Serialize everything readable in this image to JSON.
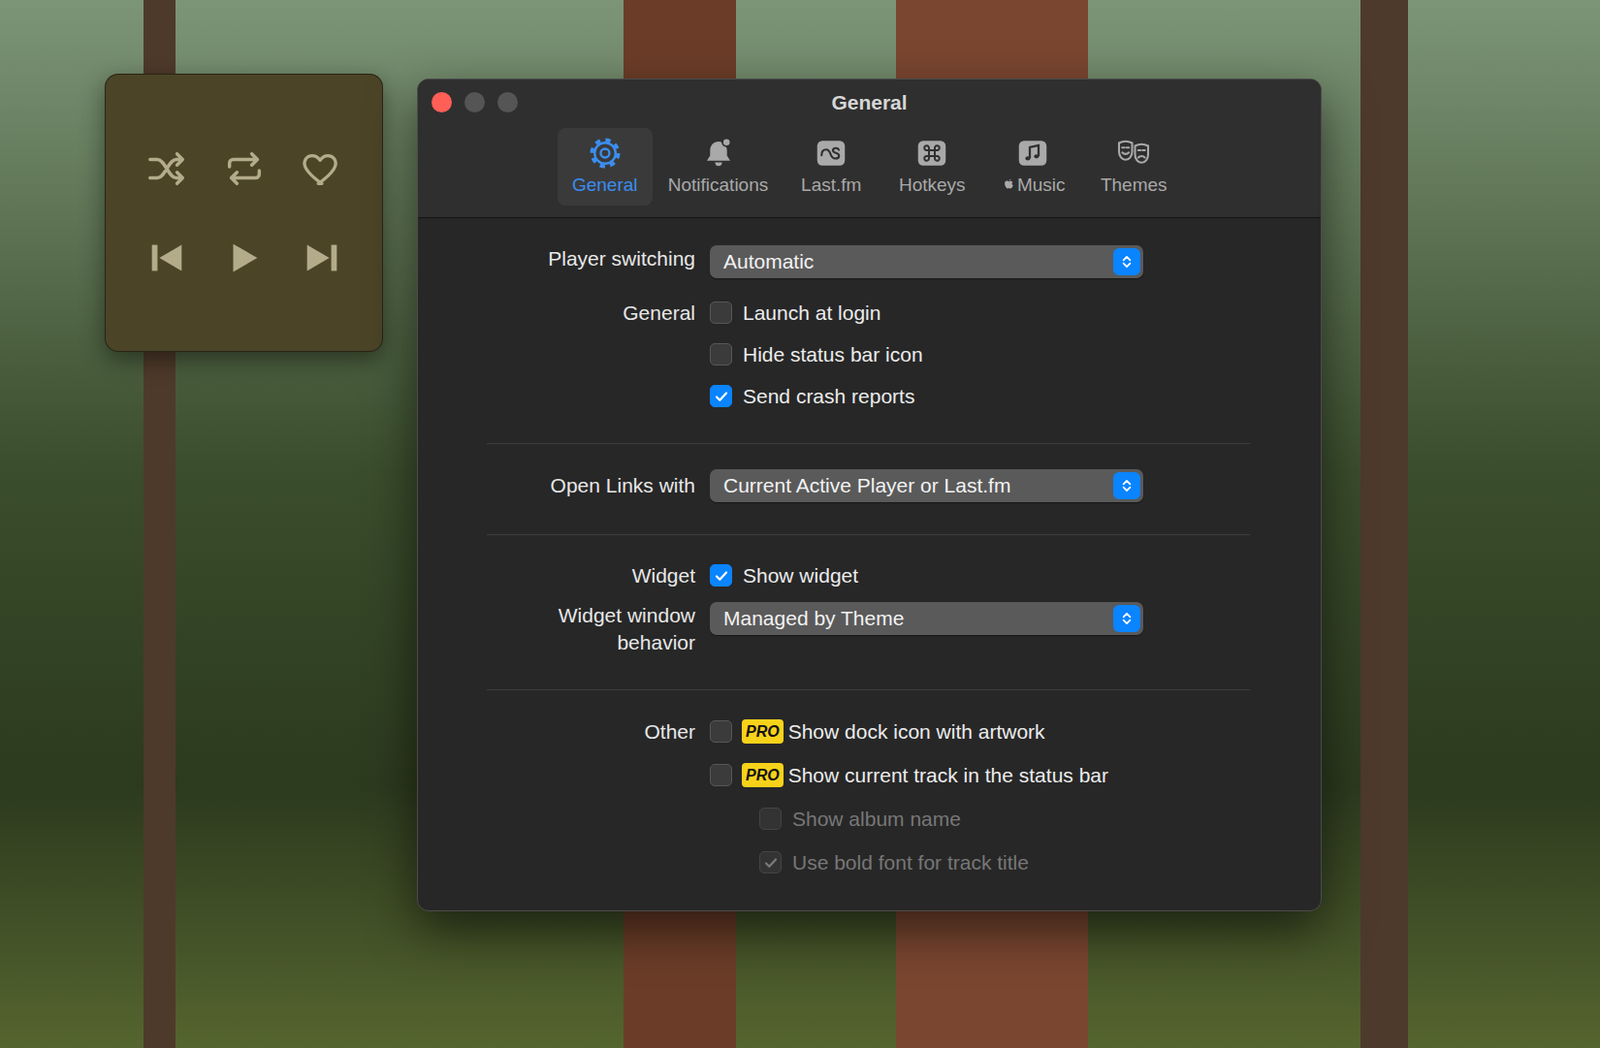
{
  "window": {
    "title": "General"
  },
  "tabs": [
    {
      "label": "General",
      "selected": true
    },
    {
      "label": "Notifications",
      "selected": false
    },
    {
      "label": "Last.fm",
      "selected": false
    },
    {
      "label": "Hotkeys",
      "selected": false
    },
    {
      "label": "Music",
      "selected": false
    },
    {
      "label": "Themes",
      "selected": false
    }
  ],
  "player_switching": {
    "label": "Player switching",
    "value": "Automatic"
  },
  "general": {
    "label": "General",
    "options": [
      {
        "label": "Launch at login",
        "checked": false
      },
      {
        "label": "Hide status bar icon",
        "checked": false
      },
      {
        "label": "Send crash reports",
        "checked": true
      }
    ]
  },
  "open_links": {
    "label": "Open Links with",
    "value": "Current Active Player or Last.fm"
  },
  "widget": {
    "label": "Widget",
    "option": {
      "label": "Show widget",
      "checked": true
    }
  },
  "widget_behavior": {
    "label": "Widget window behavior",
    "value": "Managed by Theme"
  },
  "other": {
    "label": "Other",
    "options": [
      {
        "label": "Show dock icon with artwork",
        "checked": false,
        "disabled": false,
        "badge": "PRO",
        "kind": "main"
      },
      {
        "label": "Show current track in the status bar",
        "checked": false,
        "disabled": false,
        "badge": "PRO",
        "kind": "main"
      },
      {
        "label": "Show album name",
        "checked": false,
        "disabled": true,
        "badge": "",
        "kind": "sub"
      },
      {
        "label": "Use bold font for track title",
        "checked": true,
        "disabled": true,
        "badge": "",
        "kind": "sub"
      }
    ]
  },
  "player_widget": {
    "shuffle_on": false,
    "repeat_on": false,
    "liked": false,
    "playing": false
  }
}
